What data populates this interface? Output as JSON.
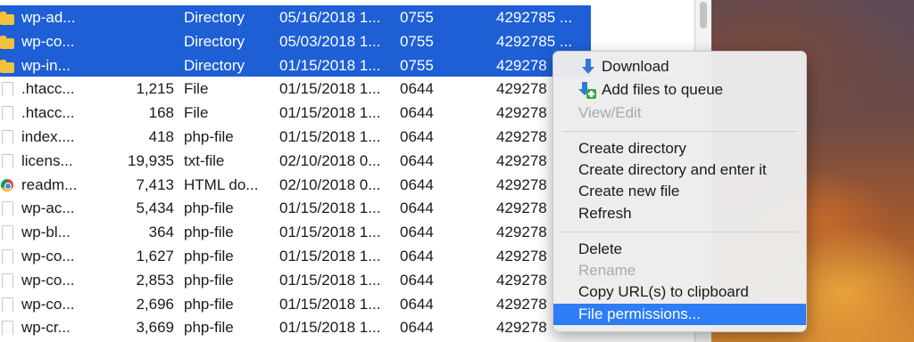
{
  "files": [
    {
      "icon": "folder-icon",
      "name": "wp-ad...",
      "size": "",
      "type": "Directory",
      "date": "05/16/2018 1...",
      "perm": "0755",
      "owner": "4292785 ...",
      "selected": true
    },
    {
      "icon": "folder-icon",
      "name": "wp-co...",
      "size": "",
      "type": "Directory",
      "date": "05/03/2018 1...",
      "perm": "0755",
      "owner": "4292785 ...",
      "selected": true
    },
    {
      "icon": "folder-icon",
      "name": "wp-in...",
      "size": "",
      "type": "Directory",
      "date": "01/15/2018 1...",
      "perm": "0755",
      "owner": "429278",
      "selected": true
    },
    {
      "icon": "document-icon",
      "name": ".htacc...",
      "size": "1,215",
      "type": "File",
      "date": "01/15/2018 1...",
      "perm": "0644",
      "owner": "429278",
      "selected": false
    },
    {
      "icon": "document-icon",
      "name": ".htacc...",
      "size": "168",
      "type": "File",
      "date": "01/15/2018 1...",
      "perm": "0644",
      "owner": "429278",
      "selected": false
    },
    {
      "icon": "document-icon",
      "name": "index....",
      "size": "418",
      "type": "php-file",
      "date": "01/15/2018 1...",
      "perm": "0644",
      "owner": "429278",
      "selected": false
    },
    {
      "icon": "document-icon",
      "name": "licens...",
      "size": "19,935",
      "type": "txt-file",
      "date": "02/10/2018 0...",
      "perm": "0644",
      "owner": "429278",
      "selected": false
    },
    {
      "icon": "chrome-icon",
      "name": "readm...",
      "size": "7,413",
      "type": "HTML do...",
      "date": "02/10/2018 0...",
      "perm": "0644",
      "owner": "429278",
      "selected": false
    },
    {
      "icon": "document-icon",
      "name": "wp-ac...",
      "size": "5,434",
      "type": "php-file",
      "date": "01/15/2018 1...",
      "perm": "0644",
      "owner": "429278",
      "selected": false
    },
    {
      "icon": "document-icon",
      "name": "wp-bl...",
      "size": "364",
      "type": "php-file",
      "date": "01/15/2018 1...",
      "perm": "0644",
      "owner": "429278",
      "selected": false
    },
    {
      "icon": "document-icon",
      "name": "wp-co...",
      "size": "1,627",
      "type": "php-file",
      "date": "01/15/2018 1...",
      "perm": "0644",
      "owner": "429278",
      "selected": false
    },
    {
      "icon": "document-icon",
      "name": "wp-co...",
      "size": "2,853",
      "type": "php-file",
      "date": "01/15/2018 1...",
      "perm": "0644",
      "owner": "429278",
      "selected": false
    },
    {
      "icon": "document-icon",
      "name": "wp-co...",
      "size": "2,696",
      "type": "php-file",
      "date": "01/15/2018 1...",
      "perm": "0644",
      "owner": "429278",
      "selected": false
    },
    {
      "icon": "document-icon",
      "name": "wp-cr...",
      "size": "3,669",
      "type": "php-file",
      "date": "01/15/2018 1...",
      "perm": "0644",
      "owner": "429278",
      "selected": false
    }
  ],
  "context_menu": {
    "download": {
      "label": "Download",
      "icon": "download-icon"
    },
    "add_to_queue": {
      "label": "Add files to queue",
      "icon": "add-to-queue-icon"
    },
    "view_edit": {
      "label": "View/Edit",
      "disabled": true
    },
    "create_directory": {
      "label": "Create directory"
    },
    "create_directory_enter": {
      "label": "Create directory and enter it"
    },
    "create_file": {
      "label": "Create new file"
    },
    "refresh": {
      "label": "Refresh"
    },
    "delete": {
      "label": "Delete"
    },
    "rename": {
      "label": "Rename",
      "disabled": true
    },
    "copy_url": {
      "label": "Copy URL(s) to clipboard"
    },
    "file_permissions": {
      "label": "File permissions...",
      "highlighted": true
    }
  },
  "colors": {
    "selection": "#1e5fd6",
    "menu_highlight": "#2e7cf6",
    "disabled_text": "#a9a9a9"
  }
}
